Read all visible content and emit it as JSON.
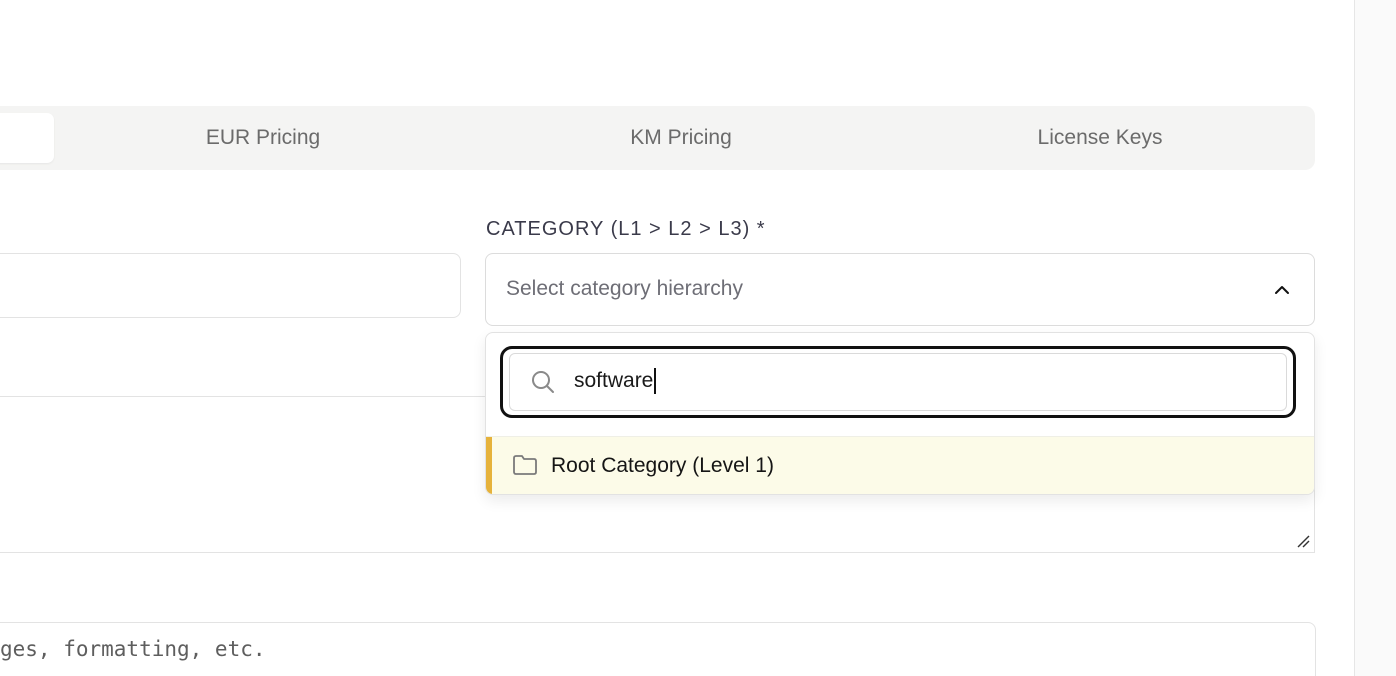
{
  "tabs": {
    "items": [
      "EUR Pricing",
      "KM Pricing",
      "License Keys"
    ]
  },
  "category": {
    "label": "CATEGORY (L1 > L2 > L3) *",
    "placeholder": "Select category hierarchy",
    "search_value": "software",
    "options": [
      {
        "label": "Root Category (Level 1)",
        "icon": "folder-icon"
      }
    ]
  },
  "editor": {
    "placeholder_fragment": "ges, formatting, etc."
  },
  "icons": {
    "search": "search-icon",
    "chevron": "chevron-up-icon",
    "resize": "resize-handle-icon"
  },
  "colors": {
    "option_highlight": "#fcfbe8",
    "option_accent": "#e6b23b",
    "focus_ring": "#111111",
    "tab_bar": "#f4f4f3"
  }
}
